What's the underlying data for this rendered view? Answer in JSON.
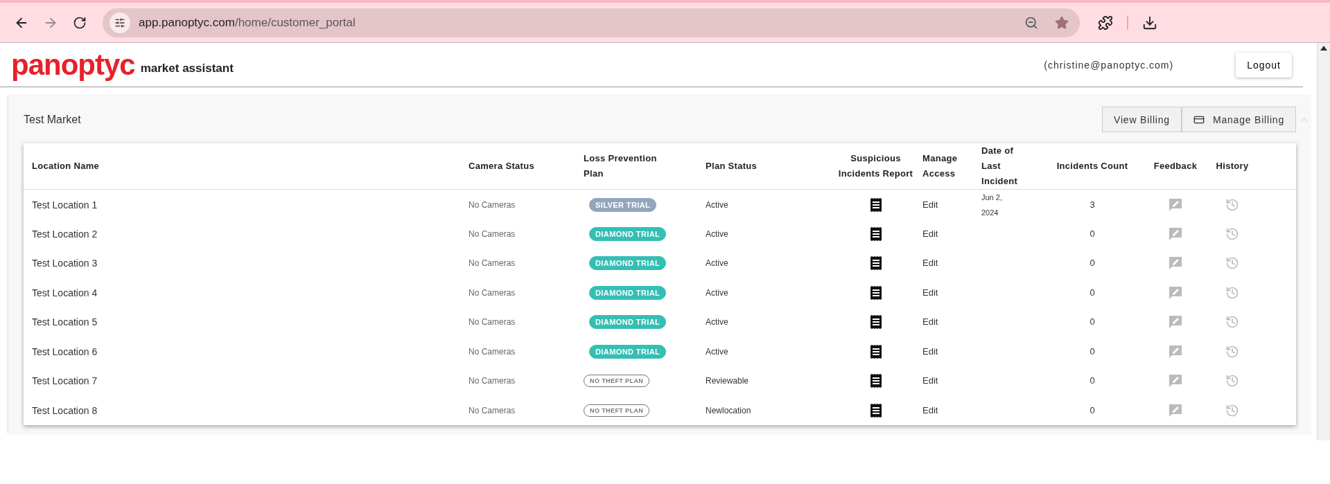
{
  "browser": {
    "url_host": "app.panoptyc.com",
    "url_path": "/home/customer_portal",
    "forward_disabled": true
  },
  "header": {
    "logo": "panoptyc",
    "subtitle": "market assistant",
    "user": "(christine@panoptyc.com)",
    "logout": "Logout"
  },
  "market": {
    "title": "Test Market",
    "buttons": [
      "View Billing",
      "Manage Billing"
    ]
  },
  "table": {
    "columns": [
      "Location Name",
      "Camera Status",
      "Loss Prevention Plan",
      "Plan Status",
      "Suspicious Incidents Report",
      "Manage Access",
      "Date of Last Incident",
      "Incidents Count",
      "Feedback",
      "History"
    ],
    "rows": [
      {
        "name": "Test Location 1",
        "camera": "No Cameras",
        "plan": {
          "kind": "silver",
          "label": "SILVER TRIAL"
        },
        "status": "Active",
        "access": "Edit",
        "date": "Jun 2, 2024",
        "count": "3"
      },
      {
        "name": "Test Location 2",
        "camera": "No Cameras",
        "plan": {
          "kind": "diamond",
          "label": "DIAMOND TRIAL"
        },
        "status": "Active",
        "access": "Edit",
        "count": "0"
      },
      {
        "name": "Test Location 3",
        "camera": "No Cameras",
        "plan": {
          "kind": "diamond",
          "label": "DIAMOND TRIAL"
        },
        "status": "Active",
        "access": "Edit",
        "count": "0"
      },
      {
        "name": "Test Location 4",
        "camera": "No Cameras",
        "plan": {
          "kind": "diamond",
          "label": "DIAMOND TRIAL"
        },
        "status": "Active",
        "access": "Edit",
        "count": "0"
      },
      {
        "name": "Test Location 5",
        "camera": "No Cameras",
        "plan": {
          "kind": "diamond",
          "label": "DIAMOND TRIAL"
        },
        "status": "Active",
        "access": "Edit",
        "count": "0"
      },
      {
        "name": "Test Location 6",
        "camera": "No Cameras",
        "plan": {
          "kind": "diamond",
          "label": "DIAMOND TRIAL"
        },
        "status": "Active",
        "access": "Edit",
        "count": "0"
      },
      {
        "name": "Test Location 7",
        "camera": "No Cameras",
        "plan": {
          "kind": "none",
          "label": "NO THEFT PLAN"
        },
        "status": "Reviewable",
        "access": "Edit",
        "count": "0"
      },
      {
        "name": "Test Location 8",
        "camera": "No Cameras",
        "plan": {
          "kind": "none",
          "label": "NO THEFT PLAN"
        },
        "status": "Newlocation",
        "access": "Edit",
        "count": "0"
      }
    ]
  }
}
